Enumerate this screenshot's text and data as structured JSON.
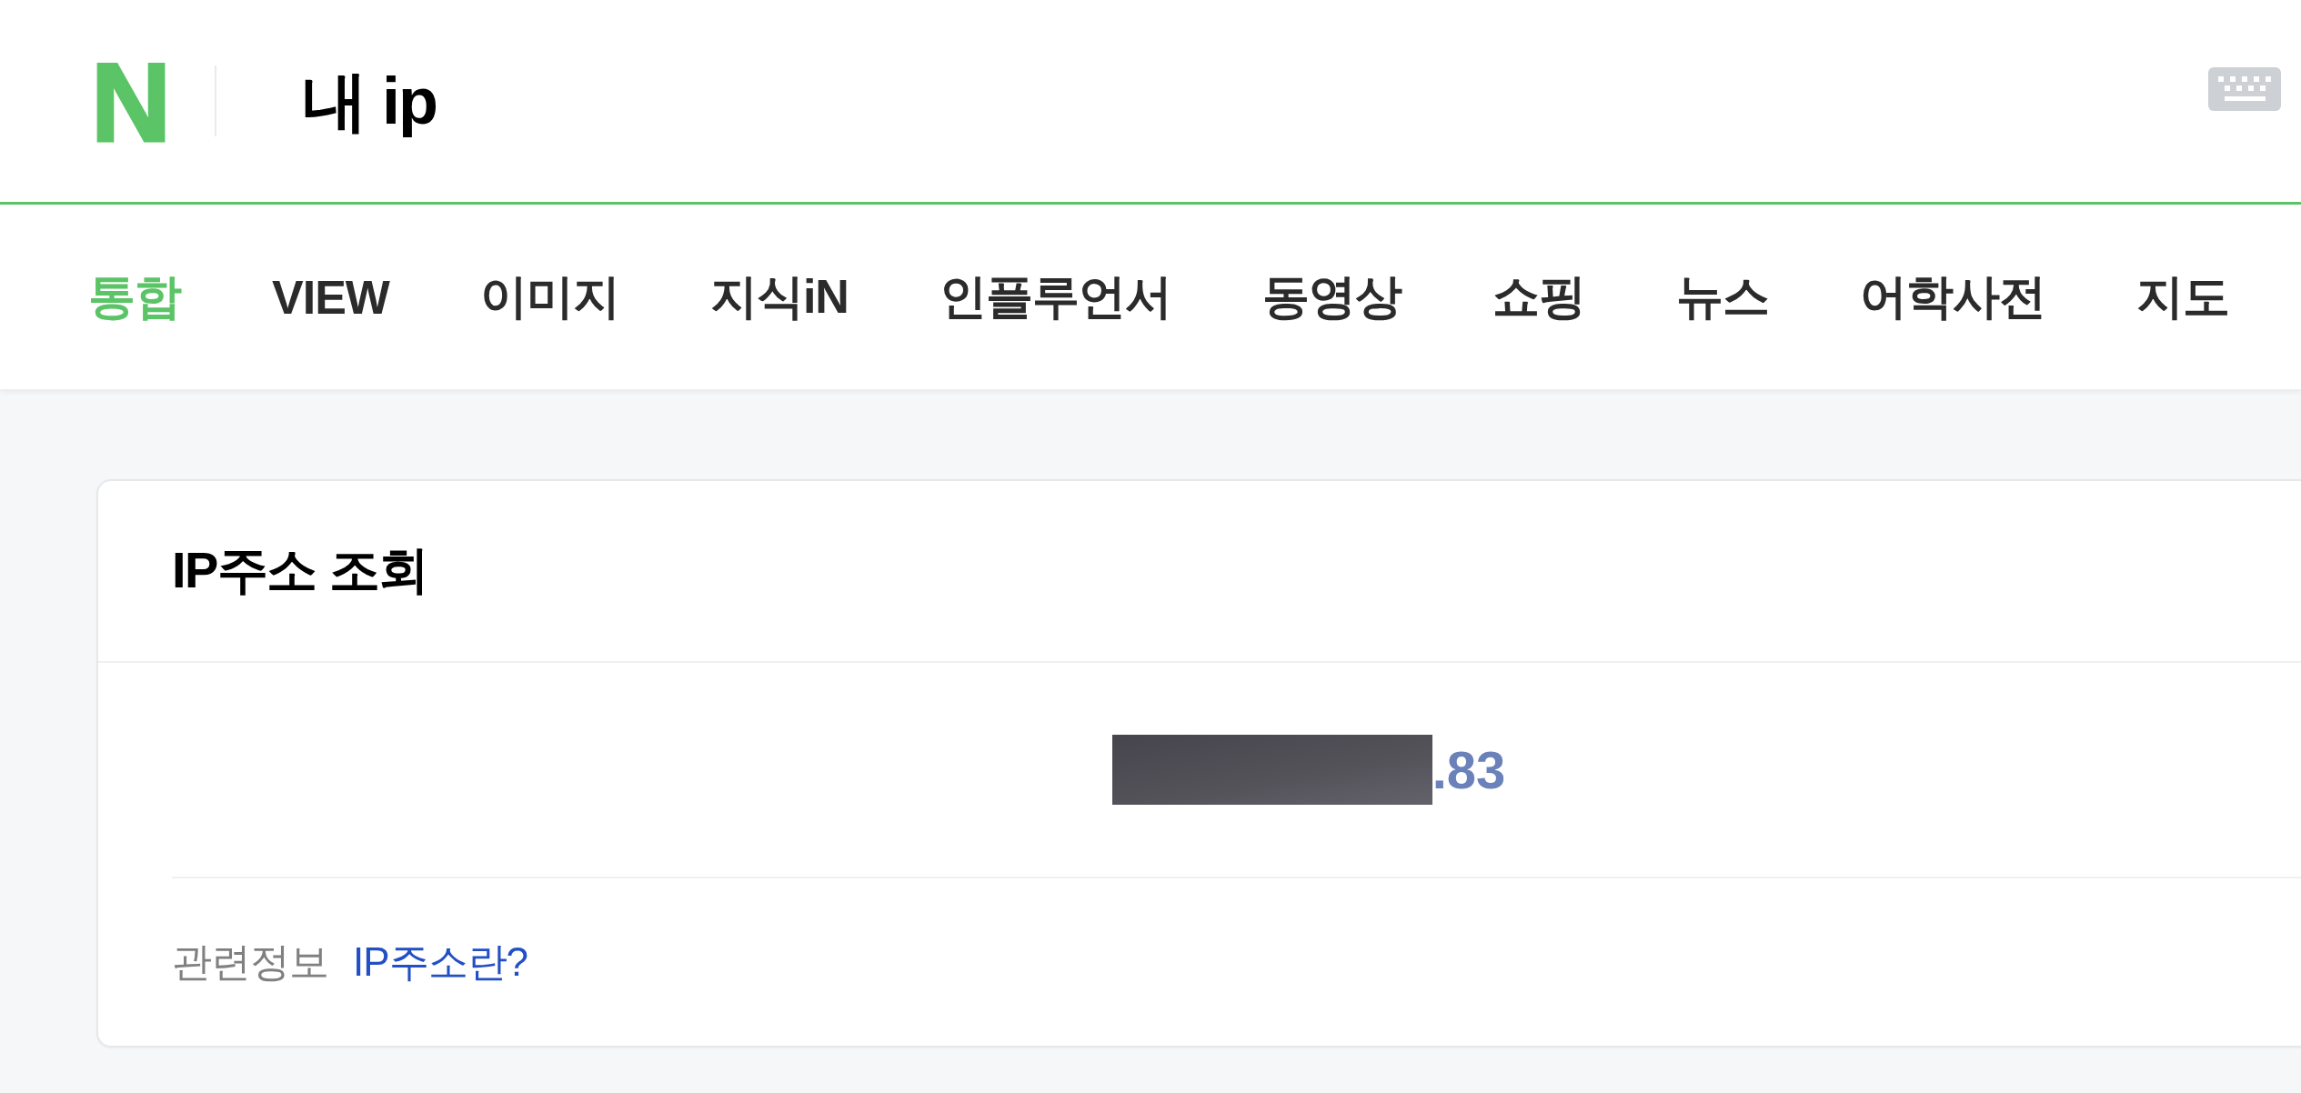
{
  "header": {
    "logo": "N",
    "title": "내 ip"
  },
  "tabs": [
    {
      "label": "통합",
      "selected": true
    },
    {
      "label": "VIEW",
      "selected": false
    },
    {
      "label": "이미지",
      "selected": false
    },
    {
      "label": "지식iN",
      "selected": false
    },
    {
      "label": "인플루언서",
      "selected": false
    },
    {
      "label": "동영상",
      "selected": false
    },
    {
      "label": "쇼핑",
      "selected": false
    },
    {
      "label": "뉴스",
      "selected": false
    },
    {
      "label": "어학사전",
      "selected": false
    },
    {
      "label": "지도",
      "selected": false
    }
  ],
  "card": {
    "title": "IP주소 조회",
    "ip_address": {
      "text": ".83",
      "redacted": true
    },
    "related": {
      "label": "관련정보",
      "link": "IP주소란?"
    }
  }
}
